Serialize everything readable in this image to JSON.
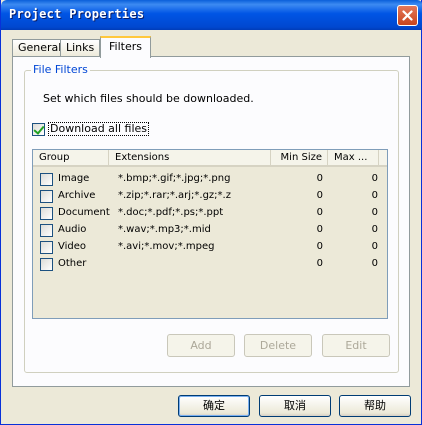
{
  "window": {
    "title": "Project Properties"
  },
  "tabs": [
    {
      "label": "General"
    },
    {
      "label": "Links"
    },
    {
      "label": "Filters"
    }
  ],
  "filters": {
    "group_label": "File Filters",
    "description": "Set which files should be downloaded.",
    "download_all": {
      "label": "Download all files",
      "checked": true
    },
    "columns": [
      "Group",
      "Extensions",
      "Min Size",
      "Max ..."
    ],
    "rows": [
      {
        "group": "Image",
        "extensions": "*.bmp;*.gif;*.jpg;*.png",
        "min": "0",
        "max": "0",
        "checked": false
      },
      {
        "group": "Archive",
        "extensions": "*.zip;*.rar;*.arj;*.gz;*.z",
        "min": "0",
        "max": "0",
        "checked": false
      },
      {
        "group": "Document",
        "extensions": "*.doc;*.pdf;*.ps;*.ppt",
        "min": "0",
        "max": "0",
        "checked": false
      },
      {
        "group": "Audio",
        "extensions": "*.wav;*.mp3;*.mid",
        "min": "0",
        "max": "0",
        "checked": false
      },
      {
        "group": "Video",
        "extensions": "*.avi;*.mov;*.mpeg",
        "min": "0",
        "max": "0",
        "checked": false
      },
      {
        "group": "Other",
        "extensions": "",
        "min": "0",
        "max": "0",
        "checked": false
      }
    ],
    "buttons": {
      "add": "Add",
      "delete": "Delete",
      "edit": "Edit"
    }
  },
  "footer": {
    "ok": "确定",
    "cancel": "取消",
    "help": "帮助"
  },
  "icons": {
    "close": "close-icon"
  },
  "colors": {
    "titlebar": "#0055e5",
    "group_label": "#0046d5",
    "tab_highlight": "#ffc83c"
  }
}
